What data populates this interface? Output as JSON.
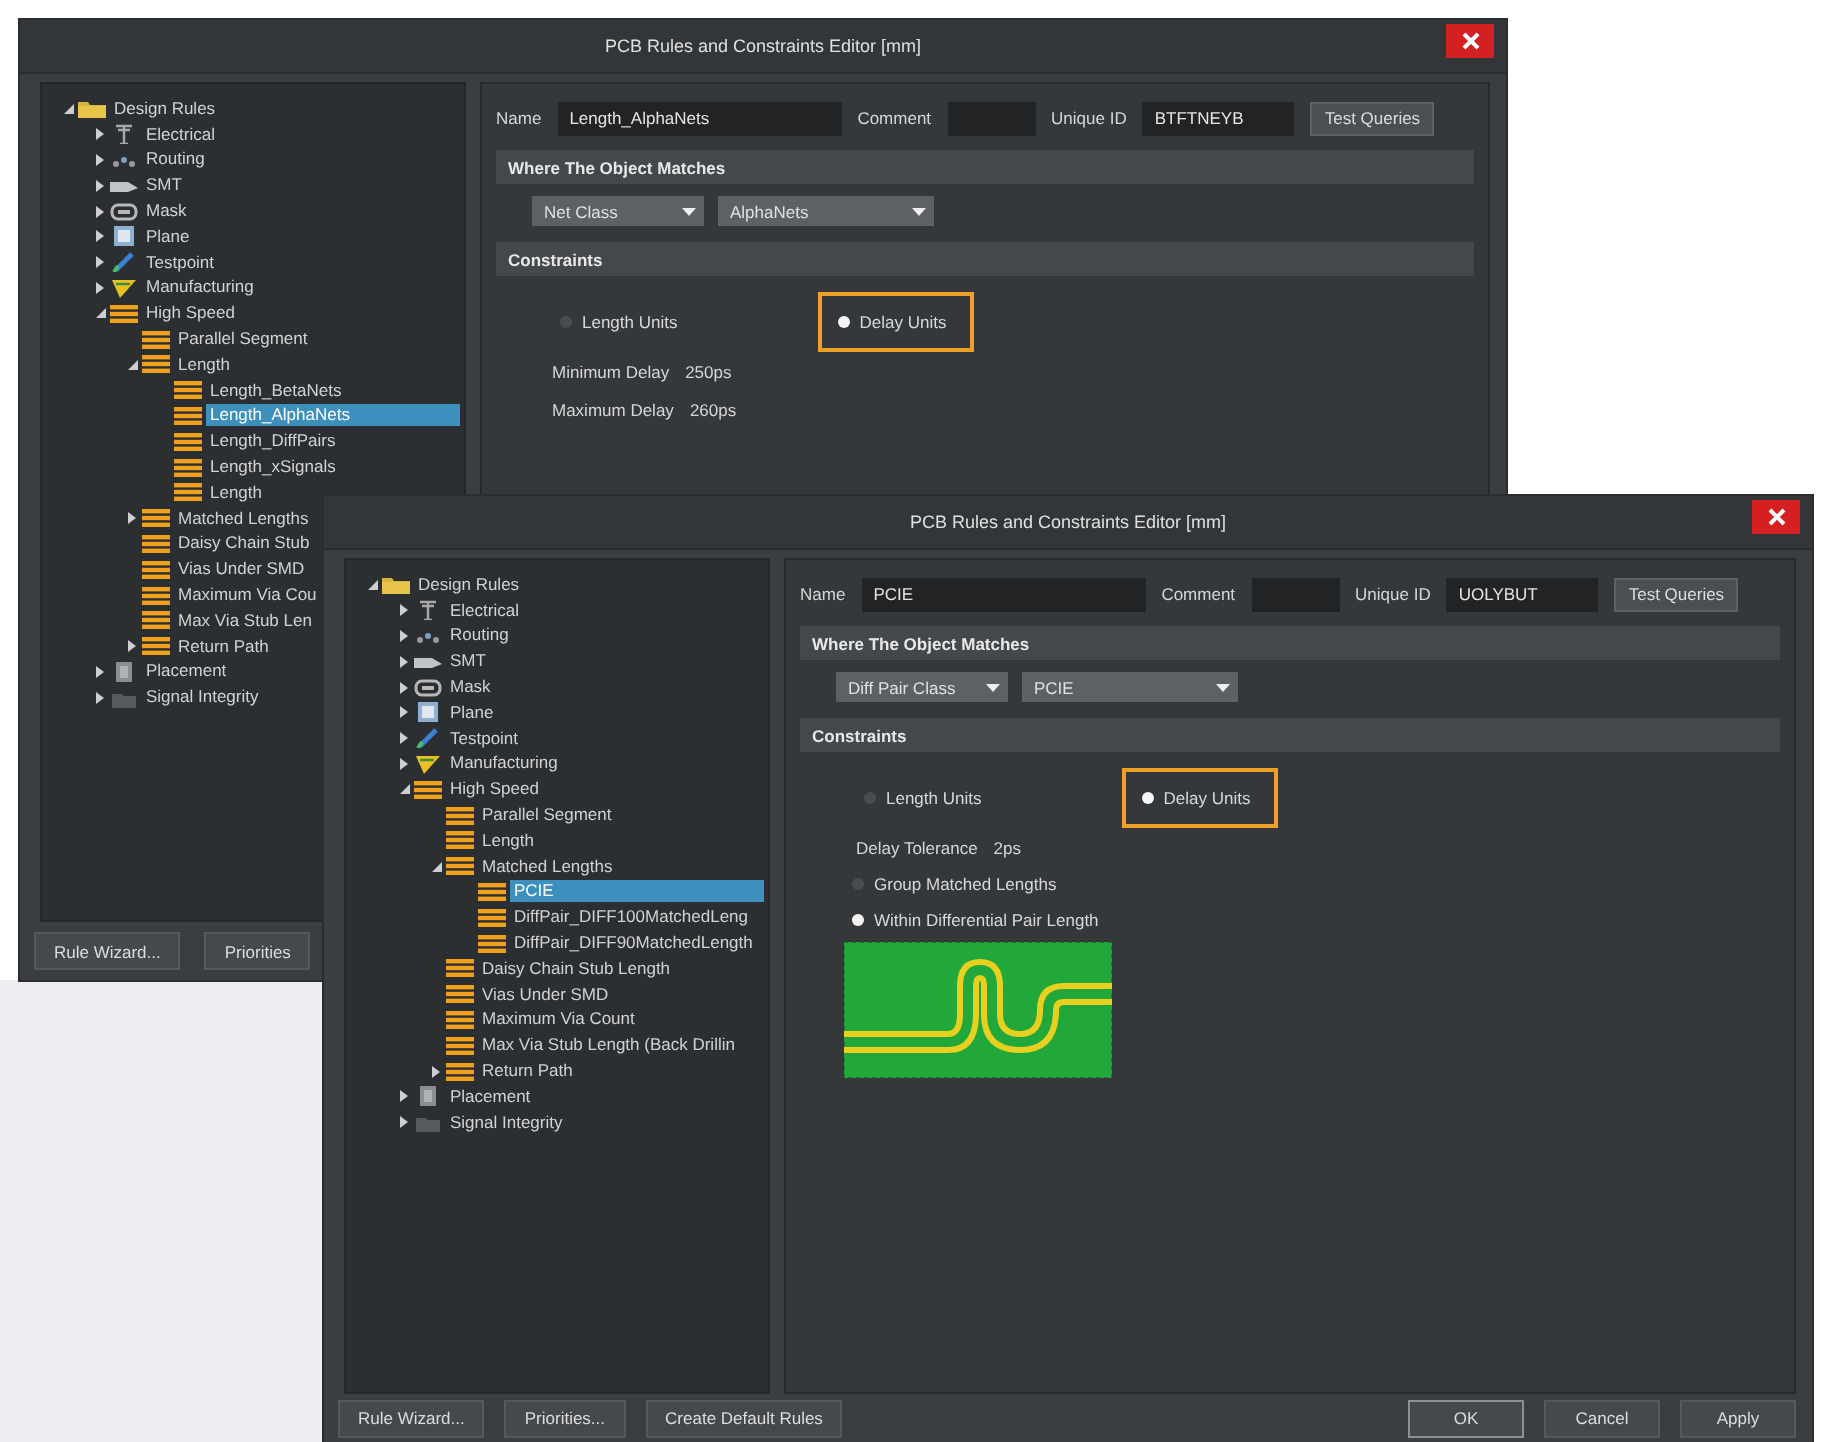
{
  "windows": [
    {
      "title": "PCB Rules and Constraints Editor [mm]",
      "tree": [
        {
          "label": "Design Rules",
          "kind": "folder",
          "expanded": true,
          "children": [
            {
              "label": "Electrical",
              "kind": "pylon",
              "expanded": false
            },
            {
              "label": "Routing",
              "kind": "dots",
              "expanded": false
            },
            {
              "label": "SMT",
              "kind": "pad",
              "expanded": false
            },
            {
              "label": "Mask",
              "kind": "chip",
              "expanded": false
            },
            {
              "label": "Plane",
              "kind": "square",
              "expanded": false
            },
            {
              "label": "Testpoint",
              "kind": "probe",
              "expanded": false
            },
            {
              "label": "Manufacturing",
              "kind": "wedge",
              "expanded": false
            },
            {
              "label": "High Speed",
              "kind": "rule",
              "expanded": true,
              "children": [
                {
                  "label": "Parallel Segment",
                  "kind": "rule"
                },
                {
                  "label": "Length",
                  "kind": "rule",
                  "expanded": true,
                  "children": [
                    {
                      "label": "Length_BetaNets",
                      "kind": "rule",
                      "selected": false
                    },
                    {
                      "label": "Length_AlphaNets",
                      "kind": "rule",
                      "selected": true
                    },
                    {
                      "label": "Length_DiffPairs",
                      "kind": "rule",
                      "selected": false
                    },
                    {
                      "label": "Length_xSignals",
                      "kind": "rule",
                      "selected": false
                    },
                    {
                      "label": "Length",
                      "kind": "rule",
                      "selected": false
                    }
                  ]
                },
                {
                  "label": "Matched Lengths",
                  "kind": "rule",
                  "expanded": false
                },
                {
                  "label": "Daisy Chain Stub",
                  "kind": "rule"
                },
                {
                  "label": "Vias Under SMD",
                  "kind": "rule"
                },
                {
                  "label": "Maximum Via Cou",
                  "kind": "rule"
                },
                {
                  "label": "Max Via Stub Len",
                  "kind": "rule"
                },
                {
                  "label": "Return Path",
                  "kind": "rule",
                  "expanded": false
                }
              ]
            },
            {
              "label": "Placement",
              "kind": "block",
              "expanded": false
            },
            {
              "label": "Signal Integrity",
              "kind": "faded",
              "expanded": false
            }
          ]
        }
      ],
      "name_label": "Name",
      "name": "Length_AlphaNets",
      "comment_label": "Comment",
      "unique_id_label": "Unique ID",
      "unique_id": "BTFTNEYB",
      "test_button": "Test Queries",
      "match_header": "Where The Object Matches",
      "match_dropdowns": [
        "Net Class",
        "AlphaNets"
      ],
      "constraints_header": "Constraints",
      "units": [
        {
          "label": "Length Units",
          "selected": false,
          "highlighted": false
        },
        {
          "label": "Delay Units",
          "selected": true,
          "highlighted": true
        }
      ],
      "constraints": [
        {
          "kind": "value",
          "label": "Minimum Delay",
          "value": "250ps"
        },
        {
          "kind": "value",
          "label": "Maximum Delay",
          "value": "260ps"
        }
      ],
      "buttons_left": [
        {
          "label": "Rule Wizard...",
          "default": false
        },
        {
          "label": "Priorities",
          "default": false
        }
      ]
    },
    {
      "title": "PCB Rules and Constraints Editor [mm]",
      "tree": [
        {
          "label": "Design Rules",
          "kind": "folder",
          "expanded": true,
          "children": [
            {
              "label": "Electrical",
              "kind": "pylon",
              "expanded": false
            },
            {
              "label": "Routing",
              "kind": "dots",
              "expanded": false
            },
            {
              "label": "SMT",
              "kind": "pad",
              "expanded": false
            },
            {
              "label": "Mask",
              "kind": "chip",
              "expanded": false
            },
            {
              "label": "Plane",
              "kind": "square",
              "expanded": false
            },
            {
              "label": "Testpoint",
              "kind": "probe",
              "expanded": false
            },
            {
              "label": "Manufacturing",
              "kind": "wedge",
              "expanded": false
            },
            {
              "label": "High Speed",
              "kind": "rule",
              "expanded": true,
              "children": [
                {
                  "label": "Parallel Segment",
                  "kind": "rule"
                },
                {
                  "label": "Length",
                  "kind": "rule"
                },
                {
                  "label": "Matched Lengths",
                  "kind": "rule",
                  "expanded": true,
                  "children": [
                    {
                      "label": "PCIE",
                      "kind": "rule",
                      "selected": true
                    },
                    {
                      "label": "DiffPair_DIFF100MatchedLeng",
                      "kind": "rule",
                      "selected": false
                    },
                    {
                      "label": "DiffPair_DIFF90MatchedLength",
                      "kind": "rule",
                      "selected": false
                    }
                  ]
                },
                {
                  "label": "Daisy Chain Stub Length",
                  "kind": "rule"
                },
                {
                  "label": "Vias Under SMD",
                  "kind": "rule"
                },
                {
                  "label": "Maximum Via Count",
                  "kind": "rule"
                },
                {
                  "label": "Max Via Stub Length (Back Drillin",
                  "kind": "rule"
                },
                {
                  "label": "Return Path",
                  "kind": "rule",
                  "expanded": false
                }
              ]
            },
            {
              "label": "Placement",
              "kind": "block",
              "expanded": false
            },
            {
              "label": "Signal Integrity",
              "kind": "faded",
              "expanded": false
            }
          ]
        }
      ],
      "name_label": "Name",
      "name": "PCIE",
      "comment_label": "Comment",
      "unique_id_label": "Unique ID",
      "unique_id": "UOLYBUT",
      "test_button": "Test Queries",
      "match_header": "Where The Object Matches",
      "match_dropdowns": [
        "Diff Pair Class",
        "PCIE"
      ],
      "constraints_header": "Constraints",
      "units": [
        {
          "label": "Length Units",
          "selected": false,
          "highlighted": false
        },
        {
          "label": "Delay Units",
          "selected": true,
          "highlighted": true
        }
      ],
      "constraints": [
        {
          "kind": "value",
          "label": "Delay Tolerance",
          "value": "2ps"
        },
        {
          "kind": "radio",
          "label": "Group Matched Lengths",
          "selected": false
        },
        {
          "kind": "radio",
          "label": "Within Differential Pair Length",
          "selected": true
        },
        {
          "kind": "diagram"
        }
      ],
      "buttons_left": [
        {
          "label": "Rule Wizard...",
          "default": false
        },
        {
          "label": "Priorities...",
          "default": false
        },
        {
          "label": "Create Default Rules",
          "default": false
        }
      ],
      "buttons_right": [
        {
          "label": "OK",
          "default": true
        },
        {
          "label": "Cancel",
          "default": false
        },
        {
          "label": "Apply",
          "default": false
        }
      ]
    }
  ]
}
